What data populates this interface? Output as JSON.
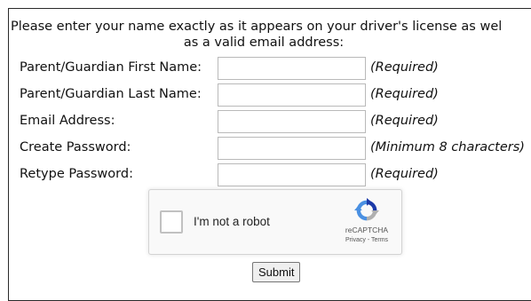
{
  "intro": {
    "line1": "Please enter your name exactly as it appears on your driver's license as wel",
    "line2": "as a valid email address:"
  },
  "form": {
    "fields": [
      {
        "label": "Parent/Guardian First Name:",
        "value": "",
        "hint": "(Required)"
      },
      {
        "label": "Parent/Guardian Last Name:",
        "value": "",
        "hint": "(Required)"
      },
      {
        "label": "Email Address:",
        "value": "",
        "hint": "(Required)"
      },
      {
        "label": "Create Password:",
        "value": "",
        "hint": "(Minimum 8 characters)"
      },
      {
        "label": "Retype Password:",
        "value": "",
        "hint": "(Required)"
      }
    ],
    "submit_label": "Submit"
  },
  "captcha": {
    "label": "I'm not a robot",
    "brand": "reCAPTCHA",
    "privacy": "Privacy",
    "separator": " - ",
    "terms": "Terms",
    "checked": false,
    "logo_icon": "recaptcha-logo-icon",
    "colors": {
      "blue": "#4a90e2",
      "dark_blue": "#1c3aa9",
      "grey": "#b0b0b0"
    }
  }
}
